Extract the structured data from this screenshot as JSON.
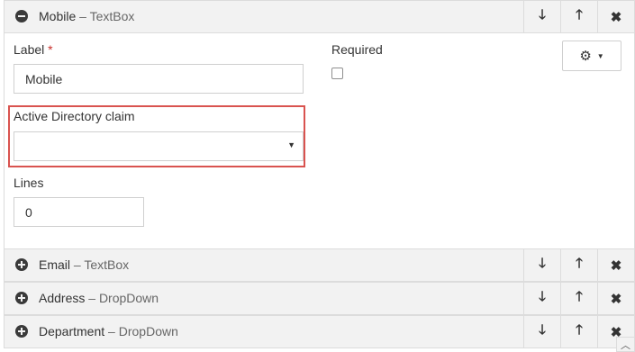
{
  "fields": [
    {
      "name": "Mobile",
      "sep": " – ",
      "type": "TextBox",
      "expanded": true
    },
    {
      "name": "Email",
      "sep": " – ",
      "type": "TextBox",
      "expanded": false
    },
    {
      "name": "Address",
      "sep": " – ",
      "type": "DropDown",
      "expanded": false
    },
    {
      "name": "Department",
      "sep": " – ",
      "type": "DropDown",
      "expanded": false
    }
  ],
  "buttons": {
    "move_down": "🡓",
    "move_up": "🡑",
    "remove": "✖"
  },
  "editor": {
    "label_label": "Label",
    "required_star": "*",
    "label_value": "Mobile",
    "required_label": "Required",
    "required_checked": false,
    "claim_label": "Active Directory claim",
    "claim_value": "",
    "lines_label": "Lines",
    "lines_value": "0",
    "settings_icon": "⚙",
    "settings_caret": "▼",
    "select_caret": "▼"
  },
  "scroll_top_icon": "︿",
  "colors": {
    "header_bg": "#f2f2f2",
    "highlight": "#d9534f",
    "required": "#c9302c"
  }
}
